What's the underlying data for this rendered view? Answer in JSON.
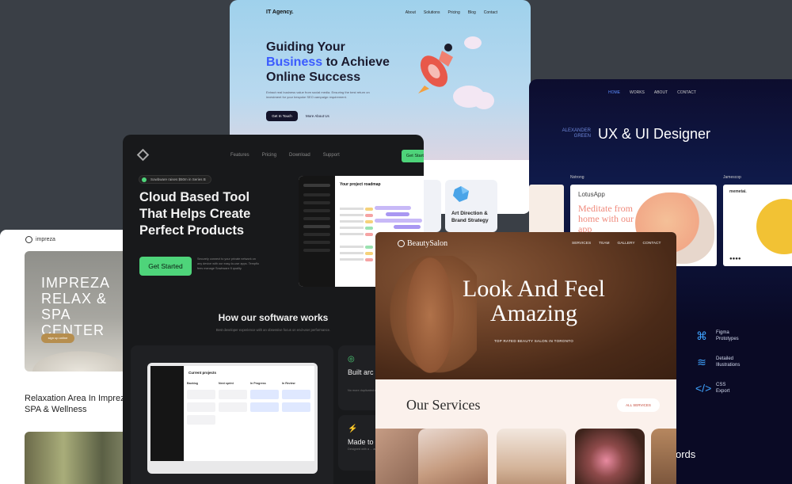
{
  "impreza": {
    "logo": "impreza",
    "hero_title": "IMPREZA\nRELAX & SPA\nCENTER",
    "cta": "sign up online",
    "subtitle": "Relaxation Area In Impreza SPA & Wellness"
  },
  "itagency": {
    "brand": "IT Agency.",
    "menu": [
      "About",
      "Solutions",
      "Pricing",
      "Blog",
      "Contact"
    ],
    "title_line1": "Guiding Your",
    "title_highlight": "Business",
    "title_line2_rest": " to Achieve",
    "title_line3": "Online Success",
    "description": "Extract real business value from social media. Ensuring the best return on investment for your bespoke SEO campaign requirement.",
    "primary_button": "Get In Touch",
    "secondary_button": "More About Us"
  },
  "uxui": {
    "menu": [
      "HOME",
      "WORKS",
      "ABOUT",
      "CONTACT"
    ],
    "designer_name": "ALEXANDER\nGREEN",
    "title": "UX & UI Designer",
    "project1_label": "Nstrong",
    "project2_label": "Jamescop",
    "lotus_title": "LotusApp",
    "lotus_tagline": "Meditate from home with our app",
    "jame_title": "memetai.",
    "features": [
      {
        "icon": "figma-icon",
        "label": "Figma\nPrototypes"
      },
      {
        "icon": "layers-icon",
        "label": "Detailed\nIllustrations"
      },
      {
        "icon": "code-icon",
        "label": "CSS\nExport"
      }
    ],
    "bottom_words": "ords"
  },
  "dark": {
    "menu": [
      "Features",
      "Pricing",
      "Download",
      "Support"
    ],
    "cta": "Get Started",
    "badge": "Sowbware raises $50m in Series B",
    "title": "Cloud Based Tool That Helps Create Perfect Products",
    "button": "Get Started",
    "side_text": "Securely connect to your private network on any device with our easy-to-use apps. Tempflo fees manage Sowbware fl quality.",
    "app_title": "Your project roadmap",
    "section_title": "How our software works",
    "section_sub": "Best developer experience with an obsessive focus on end-user performance.",
    "monitor_title": "Current projects",
    "columns": [
      "Backlog",
      "Next sprint",
      "In Progress",
      "In Review"
    ],
    "card1_title": "Built arc customer",
    "card1_desc": "No more duplicated effort ... you a single source ...",
    "card2_title": "Made to",
    "card2_desc": "Designed with a ... an opinionated w..."
  },
  "services_peek": {
    "card1": "duct",
    "card2_title": "Art Direction & Brand Strategy"
  },
  "beauty": {
    "brand": "BeautySalon",
    "menu": [
      "SERVICES",
      "TEAM",
      "GALLERY",
      "CONTACT"
    ],
    "title": "Look And Feel Amazing",
    "tagline": "TOP RATED BEAUTY SALON IN TORONTO",
    "services_title": "Our Services",
    "all_services": "ALL SERVICES"
  }
}
